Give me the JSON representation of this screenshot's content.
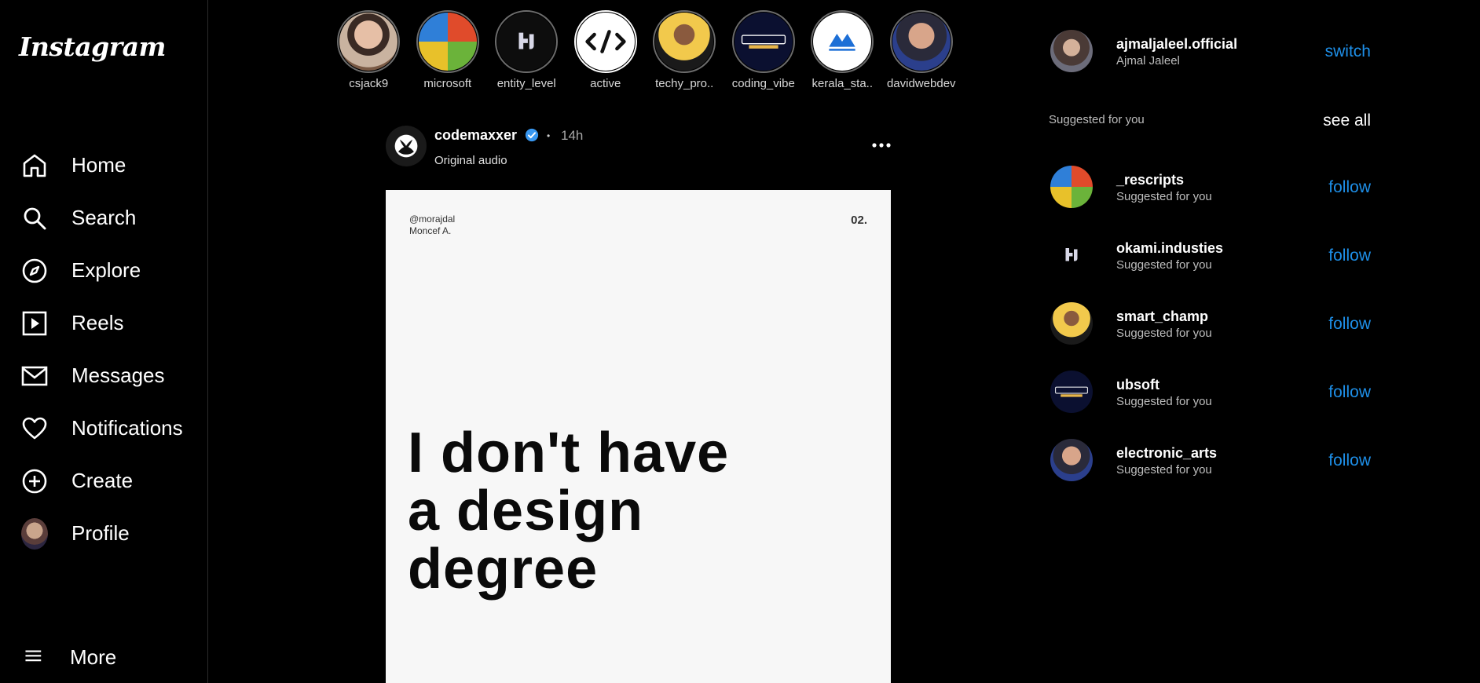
{
  "app": {
    "logo": "Instagram"
  },
  "sidebar": {
    "items": [
      {
        "label": "Home",
        "icon": "home-icon"
      },
      {
        "label": "Search",
        "icon": "search-icon"
      },
      {
        "label": "Explore",
        "icon": "compass-icon"
      },
      {
        "label": "Reels",
        "icon": "reels-icon"
      },
      {
        "label": "Messages",
        "icon": "mail-icon"
      },
      {
        "label": "Notifications",
        "icon": "heart-icon"
      },
      {
        "label": "Create",
        "icon": "plus-circle-icon"
      },
      {
        "label": "Profile",
        "icon": "avatar"
      }
    ],
    "more_label": "More"
  },
  "stories": [
    {
      "name": "csjack9"
    },
    {
      "name": "microsoft"
    },
    {
      "name": "entity_level"
    },
    {
      "name": "active"
    },
    {
      "name": "techy_pro.."
    },
    {
      "name": "coding_vibe"
    },
    {
      "name": "kerala_sta.."
    },
    {
      "name": "davidwebdev"
    }
  ],
  "post": {
    "username": "codemaxxer",
    "separator": "•",
    "time": "14h",
    "audio": "Original audio",
    "image": {
      "handle_line1": "@morajdal",
      "handle_line2": "Moncef A.",
      "page_number": "02.",
      "headline_line1": "I don't have",
      "headline_line2": "a design",
      "headline_line3": "degree"
    }
  },
  "account": {
    "username": "ajmaljaleel.official",
    "name": "Ajmal Jaleel",
    "action": "switch"
  },
  "suggestions": {
    "title": "Suggested for you",
    "see_all": "see all",
    "items": [
      {
        "username": "_rescripts",
        "sub": "Suggested for you",
        "action": "follow"
      },
      {
        "username": "okami.industies",
        "sub": "Suggested for you",
        "action": "follow"
      },
      {
        "username": "smart_champ",
        "sub": "Suggested for you",
        "action": "follow"
      },
      {
        "username": "ubsoft",
        "sub": "Suggested for you",
        "action": "follow"
      },
      {
        "username": "electronic_arts",
        "sub": "Suggested for you",
        "action": "follow"
      }
    ]
  },
  "colors": {
    "link": "#1e8fe8",
    "verified": "#3897f0",
    "background": "#000000"
  }
}
